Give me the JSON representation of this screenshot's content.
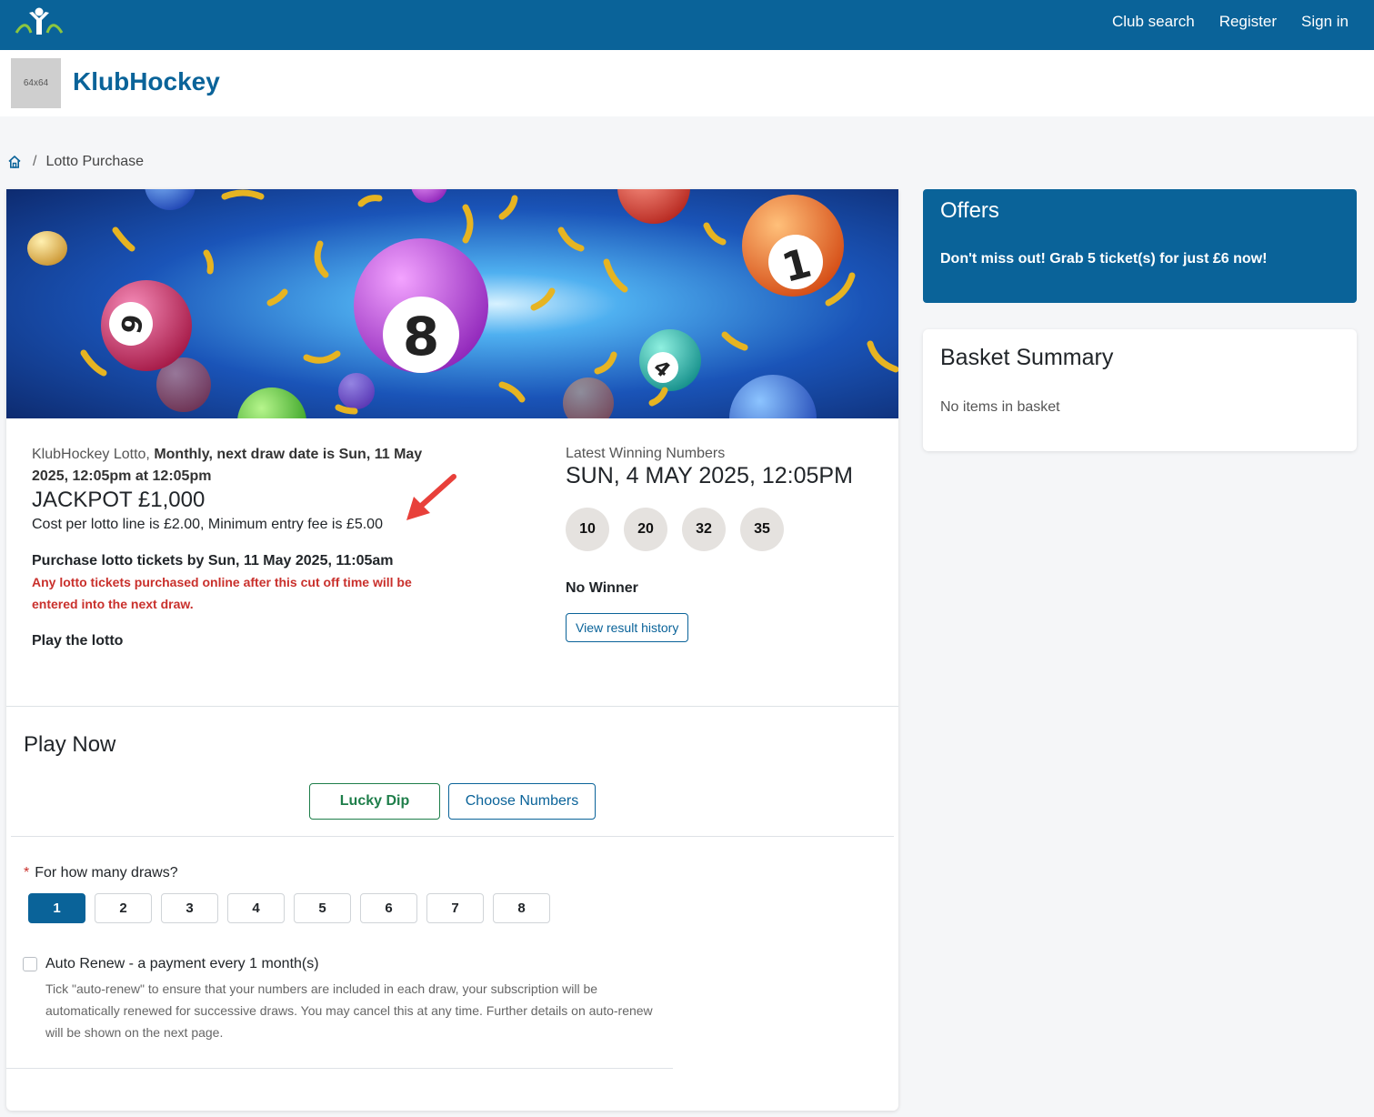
{
  "nav": {
    "links": [
      "Club search",
      "Register",
      "Sign in"
    ]
  },
  "club": {
    "avatar_placeholder": "64x64",
    "name": "KlubHockey"
  },
  "breadcrumb": {
    "current": "Lotto Purchase"
  },
  "lotto": {
    "desc_prefix": "KlubHockey Lotto,",
    "desc_bold": "Monthly, next draw date is Sun, 11 May 2025, 12:05pm at 12:05pm",
    "jackpot": "JACKPOT £1,000",
    "cost": "Cost per lotto line is £2.00, Minimum entry fee is £5.00",
    "cutoff": "Purchase lotto tickets by Sun, 11 May 2025, 11:05am",
    "warning": "Any lotto tickets purchased online after this cut off time will be entered into the next draw.",
    "play_label": "Play the lotto"
  },
  "results": {
    "label": "Latest Winning Numbers",
    "date": "SUN, 4 MAY 2025, 12:05PM",
    "numbers": [
      "10",
      "20",
      "32",
      "35"
    ],
    "winner_text": "No Winner",
    "history_button": "View result history"
  },
  "play_now": {
    "title": "Play Now",
    "lucky_dip": "Lucky Dip",
    "choose_numbers": "Choose Numbers",
    "draws_label": "For how many draws?",
    "draw_options": [
      "1",
      "2",
      "3",
      "4",
      "5",
      "6",
      "7",
      "8"
    ],
    "selected_draw": "1",
    "auto_renew_label": "Auto Renew - a payment every 1 month(s)",
    "auto_renew_help": "Tick \"auto-renew\" to ensure that your numbers are included in each draw, your subscription will be automatically renewed for successive draws. You may cancel this at any time. Further details on auto-renew will be shown on the next page.",
    "auto_renew_checked": false
  },
  "offers": {
    "title": "Offers",
    "text": "Don't miss out! Grab 5 ticket(s) for just £6 now!"
  },
  "basket": {
    "title": "Basket Summary",
    "empty_text": "No items in basket"
  },
  "colors": {
    "primary": "#0a6399",
    "success": "#1e7e4a",
    "danger": "#c9302c"
  }
}
